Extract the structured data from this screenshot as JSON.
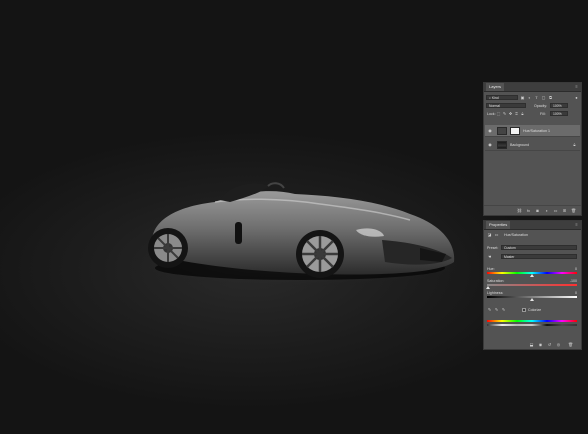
{
  "layers_panel": {
    "tab_label": "Layers",
    "filter_kind": "Kind",
    "blend_mode": "Normal",
    "opacity_label": "Opacity:",
    "opacity_value": "100%",
    "lock_label": "Lock:",
    "fill_label": "Fill:",
    "fill_value": "100%",
    "layers": [
      {
        "name": "Hue/Saturation 1",
        "selected": true
      },
      {
        "name": "Background",
        "selected": false
      }
    ]
  },
  "properties_panel": {
    "tab_label": "Properties",
    "adjustment_title": "Hue/Saturation",
    "preset_label": "Preset:",
    "preset_value": "Custom",
    "channel_value": "Master",
    "hue_label": "Hue:",
    "hue_value": "0",
    "saturation_label": "Saturation:",
    "saturation_value": "-100",
    "lightness_label": "Lightness:",
    "lightness_value": "0",
    "colorize_label": "Colorize"
  },
  "colors": {
    "panel_bg": "#535353",
    "panel_header": "#3e3e3e",
    "selected_row": "#6b6b6b",
    "canvas_bg": "#1b1b1b"
  }
}
